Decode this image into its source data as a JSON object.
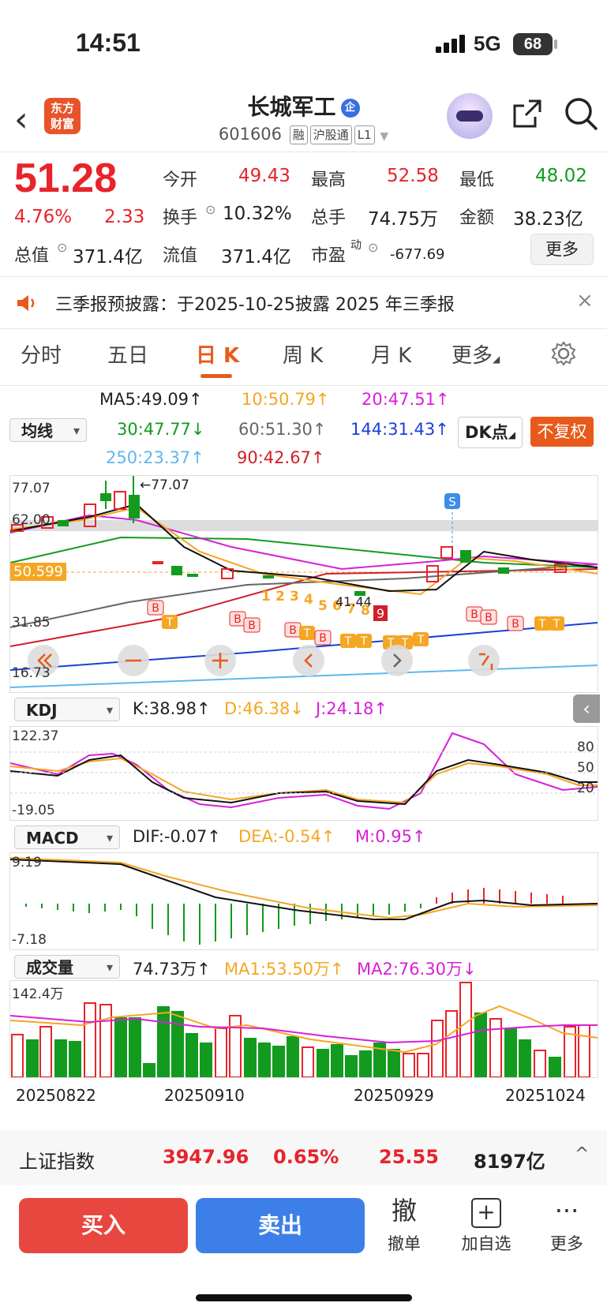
{
  "status_bar": {
    "time": "14:51",
    "network": "5G",
    "battery": "68"
  },
  "header": {
    "logo_line1": "东方",
    "logo_line2": "财富",
    "title": "长城军工",
    "title_badge": "企",
    "code": "601606",
    "tags": [
      "融",
      "沪股通",
      "L1"
    ]
  },
  "quote": {
    "price": "51.28",
    "pct": "4.76%",
    "change": "2.33",
    "rows": [
      [
        {
          "label": "今开",
          "value": "49.43",
          "color": "red"
        },
        {
          "label": "最高",
          "value": "52.58",
          "color": "red"
        },
        {
          "label": "最低",
          "value": "48.02",
          "color": "green"
        }
      ],
      [
        {
          "label": "换手",
          "value": "10.32%",
          "color": "dark"
        },
        {
          "label": "总手",
          "value": "74.75万",
          "color": "dark"
        },
        {
          "label": "金额",
          "value": "38.23亿",
          "color": "dark"
        }
      ],
      [
        {
          "label": "总值",
          "value": "371.4亿",
          "color": "dark"
        },
        {
          "label": "流值",
          "value": "371.4亿",
          "color": "dark"
        },
        {
          "label": "市盈",
          "value": "-677.69",
          "color": "dark"
        }
      ]
    ],
    "pe_superscript": "动",
    "more_label": "更多"
  },
  "notice": {
    "text": "三季报预披露：于2025-10-25披露 2025 年三季报",
    "close": "×"
  },
  "tabs": [
    "分时",
    "五日",
    "日 K",
    "周 K",
    "月 K",
    "更多"
  ],
  "active_tab": "日 K",
  "ma_legend": {
    "selector": "均线",
    "ma5": "MA5:49.09↑",
    "ma10": "10:50.79↑",
    "ma20": "20:47.51↑",
    "ma30": "30:47.77↓",
    "ma60": "60:51.30↑",
    "ma144": "144:31.43↑",
    "ma250": "250:23.37↑",
    "ma90": "90:42.67↑",
    "dk_label": "DK点",
    "fq_label": "不复权"
  },
  "kline": {
    "axis_top": "77.07",
    "axis_mid": "62.00",
    "axis_low": "31.85",
    "axis_bottom": "16.73",
    "current_price_tag": "50.599",
    "high_annotation": "←77.07",
    "low_annotation": "41.44",
    "colors": {
      "up": "#e8232b",
      "down": "#129b1e",
      "ma5": "#111111",
      "ma10": "#f5a623",
      "ma20": "#d81fd8",
      "ma30": "#129b1e",
      "ma60": "#666666",
      "ma144": "#1b3fd6",
      "ma250": "#5fb7ef",
      "ma90": "#d0202a"
    }
  },
  "kdj": {
    "selector": "KDJ",
    "k": "K:38.98↑",
    "d": "D:46.38↓",
    "j": "J:24.18↑",
    "axis_top": "122.37",
    "axis_bottom": "-19.05",
    "levels": [
      "80",
      "50",
      "20"
    ]
  },
  "macd": {
    "selector": "MACD",
    "dif": "DIF:-0.07↑",
    "dea": "DEA:-0.54↑",
    "m": "M:0.95↑",
    "axis_top": "9.19",
    "axis_bottom": "-7.18"
  },
  "volume": {
    "selector": "成交量",
    "vol": "74.73万↑",
    "ma1": "MA1:53.50万↑",
    "ma2": "MA2:76.30万↓",
    "axis_top": "142.4万"
  },
  "dates": [
    "20250822",
    "20250910",
    "20250929",
    "20251024"
  ],
  "index_bar": {
    "name": "上证指数",
    "value": "3947.96",
    "pct": "0.65%",
    "change": "25.55",
    "amount": "8197亿"
  },
  "actions": {
    "buy": "买入",
    "sell": "卖出",
    "cancel_icon": "撤",
    "cancel": "撤单",
    "add_icon": "+",
    "add": "加自选",
    "more_icon": "···",
    "more": "更多"
  }
}
